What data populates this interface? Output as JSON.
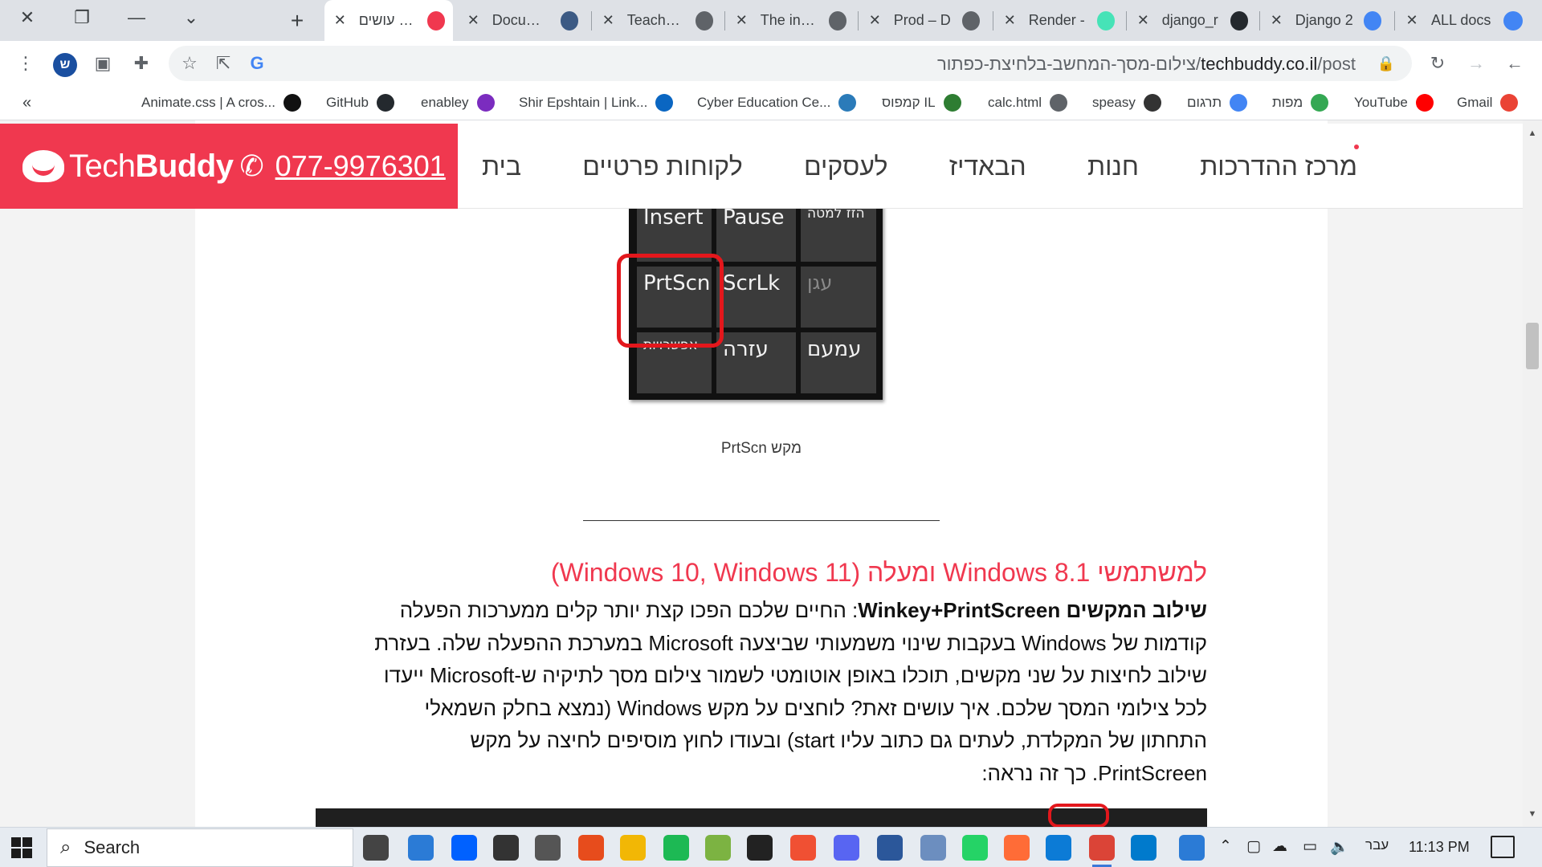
{
  "browser": {
    "tabs": [
      {
        "title": "איך עושים",
        "active": true,
        "favicon_color": "#f0384f"
      },
      {
        "title": "Document",
        "favicon_color": "#3c5a84"
      },
      {
        "title": "Teacher -",
        "favicon_color": "#5f6368"
      },
      {
        "title": "The instal",
        "favicon_color": "#5f6368"
      },
      {
        "title": "Prod – D",
        "favicon_color": "#5f6368"
      },
      {
        "title": "Render -",
        "favicon_color": "#46e3b7"
      },
      {
        "title": "django_r",
        "favicon_color": "#24292e"
      },
      {
        "title": "Django 2",
        "favicon_color": "#4285f4"
      },
      {
        "title": "ALL docs",
        "favicon_color": "#4285f4"
      }
    ],
    "new_tab_label": "+",
    "profile_initial": "ש",
    "url_domain": "techbuddy.co.il",
    "url_path": "/post/צילום-מסך-המחשב-בלחיצת-כפתור",
    "bookmarks": [
      {
        "label": "Animate.css | A cros...",
        "icon": "animate-icon",
        "color": "#111"
      },
      {
        "label": "GitHub",
        "icon": "github-icon",
        "color": "#24292e"
      },
      {
        "label": "enabley",
        "icon": "enabley-icon",
        "color": "#7b2cbf"
      },
      {
        "label": "Shir Epshtain | Link...",
        "icon": "linkedin-icon",
        "color": "#0a66c2"
      },
      {
        "label": "Cyber Education Ce...",
        "icon": "cyber-icon",
        "color": "#2b7bb9"
      },
      {
        "label": "קמפוס IL",
        "icon": "campus-icon",
        "color": "#2e7d32"
      },
      {
        "label": "calc.html",
        "icon": "globe-icon",
        "color": "#5f6368"
      },
      {
        "label": "speasy",
        "icon": "info-icon",
        "color": "#333"
      },
      {
        "label": "תרגום",
        "icon": "translate-icon",
        "color": "#4285f4"
      },
      {
        "label": "מפות",
        "icon": "maps-icon",
        "color": "#34a853"
      },
      {
        "label": "YouTube",
        "icon": "youtube-icon",
        "color": "#ff0000"
      },
      {
        "label": "Gmail",
        "icon": "gmail-icon",
        "color": "#ea4335"
      }
    ],
    "bookmarks_overflow": "«"
  },
  "site": {
    "brand_light": "Tech",
    "brand_bold": "Buddy",
    "phone": "077-9976301",
    "accent": "#f0384f",
    "nav": [
      "בית",
      "לקוחות פרטיים",
      "לעסקים",
      "הבאדיז",
      "חנות",
      "מרכז ההדרכות"
    ]
  },
  "keyboard_image": {
    "keys": [
      {
        "label": "Insert"
      },
      {
        "label": "Pause"
      },
      {
        "label": "הזז למטה"
      },
      {
        "label": "PrtScn"
      },
      {
        "label": "ScrLk"
      },
      {
        "label": "עגן"
      },
      {
        "label": "אפשרויות"
      },
      {
        "label": "עזרה"
      },
      {
        "label": "עמעם"
      }
    ]
  },
  "article": {
    "caption": "מקש PrtScn",
    "heading": "למשתמשי Windows 8.1 ומעלה (Windows 10, Windows 11)",
    "para_bold": "שילוב המקשים Winkey+PrintScreen",
    "para_text": ": החיים שלכם הפכו קצת יותר קלים ממערכות הפעלה קודמות של Windows בעקבות שינוי משמעותי שביצעה Microsoft במערכת ההפעלה שלה. בעזרת שילוב לחיצות על שני מקשים, תוכלו באופן אוטומטי לשמור צילום מסך לתיקיה ש-Microsoft ייעדו לכל צילומי המסך שלכם. איך עושים זאת? לוחצים על מקש Windows (נמצא בחלק השמאלי התחתון של המקלדת, לעתים גם כתוב עליו start) ובעודו לחוץ מוסיפים לחיצה על מקש PrintScreen. כך זה נראה:"
  },
  "taskbar": {
    "search_label": "Search",
    "apps": [
      {
        "icon": "task-view-icon",
        "color": "#444"
      },
      {
        "icon": "store-icon",
        "color": "#2b7bd6"
      },
      {
        "icon": "dropbox-icon",
        "color": "#0061ff"
      },
      {
        "icon": "github-desktop-icon",
        "color": "#333"
      },
      {
        "icon": "settings-icon",
        "color": "#555"
      },
      {
        "icon": "office-icon",
        "color": "#e74c1c"
      },
      {
        "icon": "file-explorer-icon",
        "color": "#f2b705"
      },
      {
        "icon": "spotify-icon",
        "color": "#1db954"
      },
      {
        "icon": "notepad-icon",
        "color": "#7cb342"
      },
      {
        "icon": "terminal-icon",
        "color": "#222"
      },
      {
        "icon": "git-icon",
        "color": "#f05033"
      },
      {
        "icon": "discord-icon",
        "color": "#5865f2"
      },
      {
        "icon": "word-icon",
        "color": "#2b579a"
      },
      {
        "icon": "notes-icon",
        "color": "#6c8ebf"
      },
      {
        "icon": "whatsapp-icon",
        "color": "#25d366"
      },
      {
        "icon": "postman-icon",
        "color": "#ff6c37"
      },
      {
        "icon": "edge-icon",
        "color": "#0c7bd6"
      },
      {
        "icon": "chrome-icon",
        "color": "#db4437",
        "active": true
      },
      {
        "icon": "vscode-icon",
        "color": "#007acc"
      },
      {
        "icon": "help-icon",
        "color": "#2b7bd6"
      }
    ],
    "language": "עבר",
    "time": "11:13 PM"
  }
}
